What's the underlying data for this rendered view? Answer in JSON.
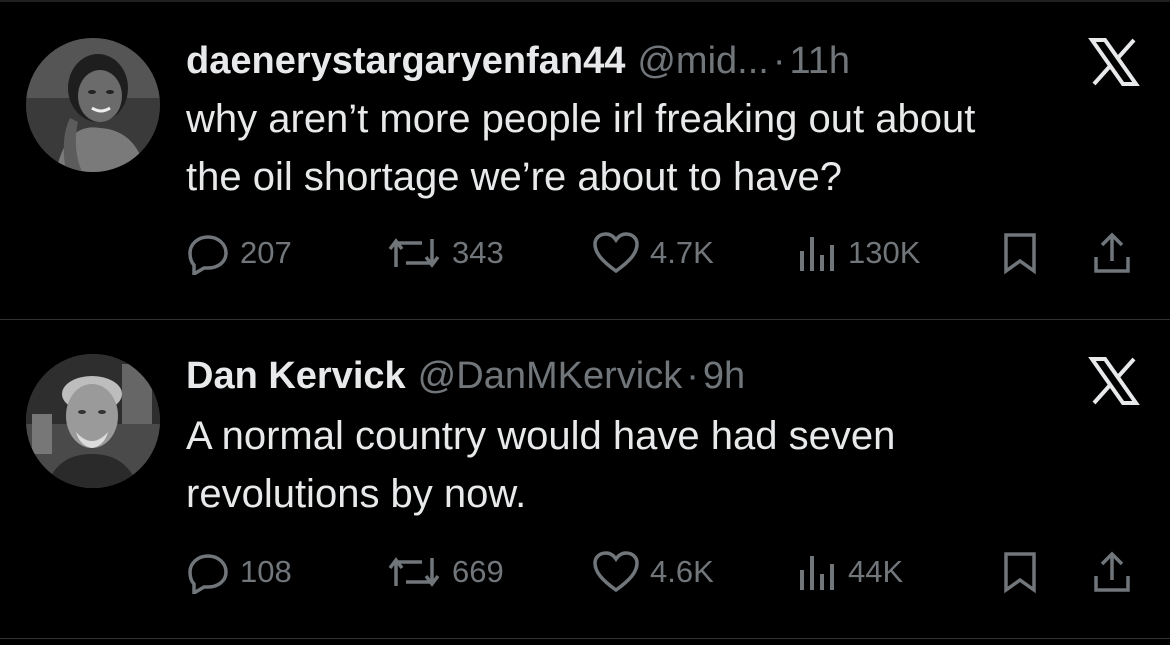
{
  "colors": {
    "background": "#000000",
    "primary_text": "#e7e9ea",
    "secondary_text": "#71767b",
    "divider": "#2f3336"
  },
  "tweets": [
    {
      "display_name": "daenerystargaryenfan44",
      "handle": "@mid...",
      "separator": "·",
      "timestamp": "11h",
      "text": "why aren’t more people irl freaking out about\nthe oil shortage we’re about to have?",
      "platform_icon": "x-logo-icon",
      "stats": {
        "replies": "207",
        "reposts": "343",
        "likes": "4.7K",
        "views": "130K"
      }
    },
    {
      "display_name": "Dan Kervick",
      "handle": "@DanMKervick",
      "separator": "·",
      "timestamp": "9h",
      "text": "A normal country would have had seven\nrevolutions by now.",
      "platform_icon": "x-logo-icon",
      "stats": {
        "replies": "108",
        "reposts": "669",
        "likes": "4.6K",
        "views": "44K"
      }
    }
  ]
}
